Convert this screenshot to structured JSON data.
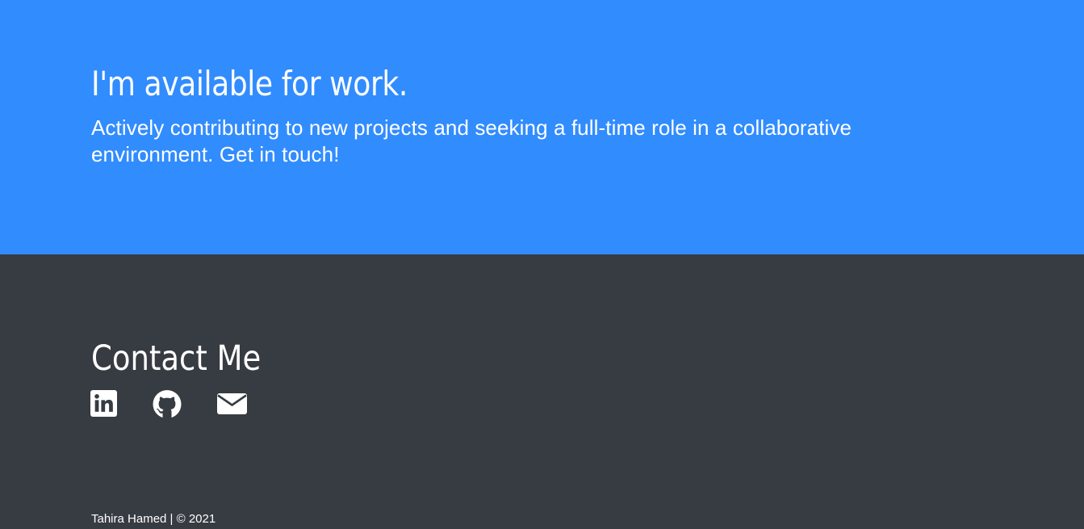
{
  "hero": {
    "title": "I'm available for work.",
    "subtitle": "Actively contributing to new projects and seeking a full-time role in a collaborative environment. Get in touch!",
    "background_color": "#318cfe"
  },
  "contact": {
    "title": "Contact Me",
    "background_color": "#373b42",
    "icons": [
      {
        "name": "linkedin-icon"
      },
      {
        "name": "github-icon"
      },
      {
        "name": "envelope-icon"
      }
    ]
  },
  "footer": {
    "text": "Tahira Hamed | © 2021"
  }
}
